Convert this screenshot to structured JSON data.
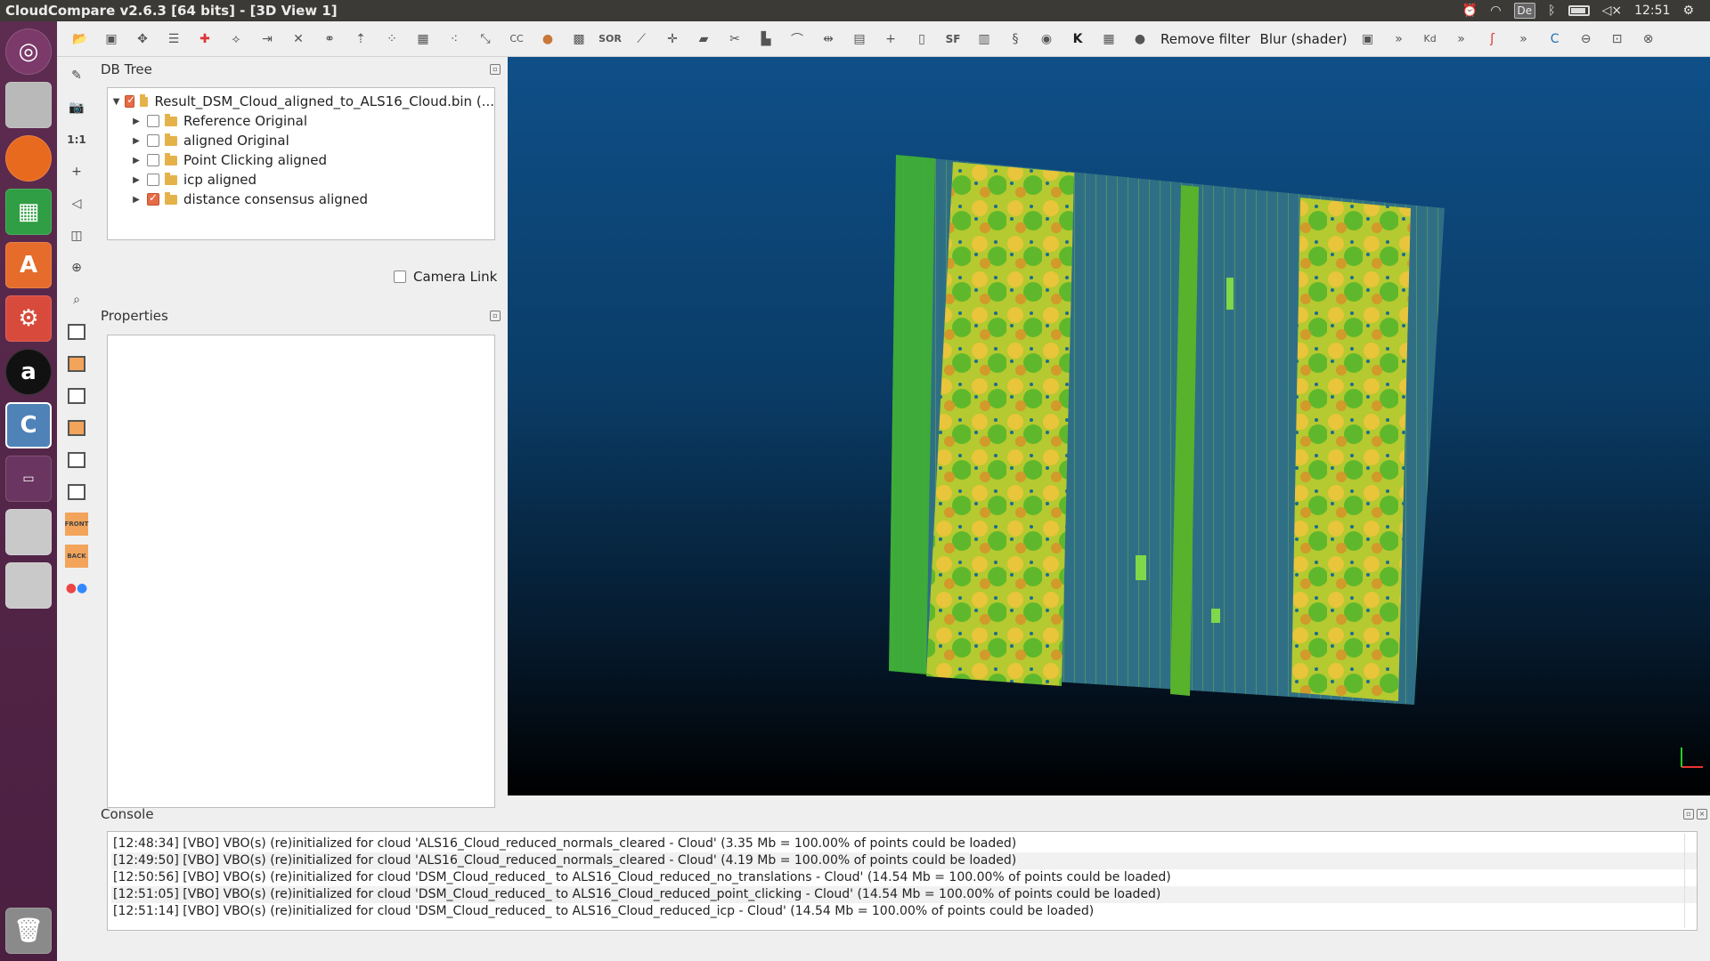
{
  "window": {
    "title": "CloudCompare v2.6.3 [64 bits] - [3D View 1]"
  },
  "tray": {
    "keyboard": "De",
    "clock": "12:51"
  },
  "toolbar": {
    "remove_filter": "Remove filter",
    "blur": "Blur (shader)",
    "sf_label": "SF",
    "sor_label": "SOR",
    "cc_label": "CC",
    "kd_label": "Kd",
    "more": "»"
  },
  "sidetools": {
    "ratio_label": "1:1",
    "front_label": "FRONT",
    "back_label": "BACK"
  },
  "dbtree": {
    "title": "DB Tree",
    "root": {
      "label": "Result_DSM_Cloud_aligned_to_ALS16_Cloud.bin (...",
      "checked": true
    },
    "items": [
      {
        "label": "Reference Original",
        "checked": false
      },
      {
        "label": "aligned Original",
        "checked": false
      },
      {
        "label": "Point Clicking aligned",
        "checked": false
      },
      {
        "label": "icp aligned",
        "checked": false
      },
      {
        "label": "distance consensus aligned",
        "checked": true
      }
    ]
  },
  "camera_link": {
    "label": "Camera Link",
    "checked": false
  },
  "properties": {
    "title": "Properties"
  },
  "console": {
    "title": "Console",
    "lines": [
      "[12:48:34] [VBO] VBO(s) (re)initialized for cloud 'ALS16_Cloud_reduced_normals_cleared - Cloud' (3.35 Mb = 100.00% of points could be loaded)",
      "[12:49:50] [VBO] VBO(s) (re)initialized for cloud 'ALS16_Cloud_reduced_normals_cleared - Cloud' (4.19 Mb = 100.00% of points could be loaded)",
      "[12:50:56] [VBO] VBO(s) (re)initialized for cloud 'DSM_Cloud_reduced_ to ALS16_Cloud_reduced_no_translations - Cloud' (14.54 Mb = 100.00% of points could be loaded)",
      "[12:51:05] [VBO] VBO(s) (re)initialized for cloud 'DSM_Cloud_reduced_ to ALS16_Cloud_reduced_point_clicking - Cloud' (14.54 Mb = 100.00% of points could be loaded)",
      "[12:51:14] [VBO] VBO(s) (re)initialized for cloud 'DSM_Cloud_reduced_ to ALS16_Cloud_reduced_icp - Cloud' (14.54 Mb = 100.00% of points could be loaded)"
    ]
  },
  "colors": {
    "accent": "#e56c46",
    "launcher": "#5d2c50",
    "view_bg_top": "#0f4f88",
    "cloud_green": "#3fb52c",
    "cloud_yellow": "#e3c23a"
  }
}
